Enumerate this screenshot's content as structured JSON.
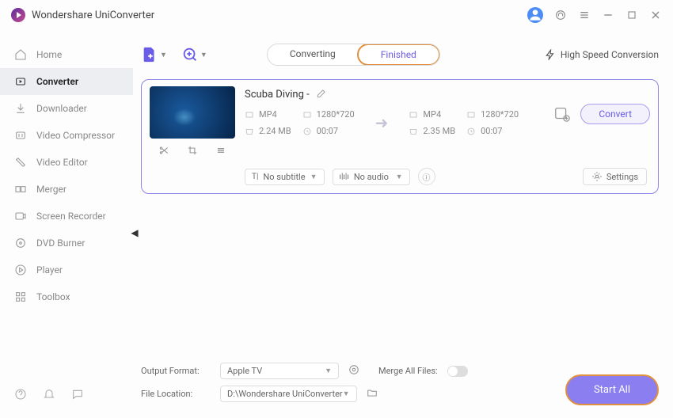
{
  "app_title": "Wondershare UniConverter",
  "nav": {
    "home": "Home",
    "converter": "Converter",
    "downloader": "Downloader",
    "compressor": "Video Compressor",
    "editor": "Video Editor",
    "merger": "Merger",
    "recorder": "Screen Recorder",
    "burner": "DVD Burner",
    "player": "Player",
    "toolbox": "Toolbox"
  },
  "tabs": {
    "converting": "Converting",
    "finished": "Finished"
  },
  "speed_label": "High Speed Conversion",
  "video": {
    "title": "Scuba Diving  -",
    "src": {
      "format": "MP4",
      "res": "1280*720",
      "size": "2.24 MB",
      "dur": "00:07"
    },
    "dst": {
      "format": "MP4",
      "res": "1280*720",
      "size": "2.35 MB",
      "dur": "00:07"
    },
    "convert_label": "Convert",
    "subtitle_sel": "No subtitle",
    "audio_sel": "No audio",
    "settings_label": "Settings"
  },
  "footer": {
    "out_format_label": "Output Format:",
    "out_format_value": "Apple TV",
    "location_label": "File Location:",
    "location_value": "D:\\Wondershare UniConverter",
    "merge_label": "Merge All Files:",
    "start_all": "Start All"
  }
}
